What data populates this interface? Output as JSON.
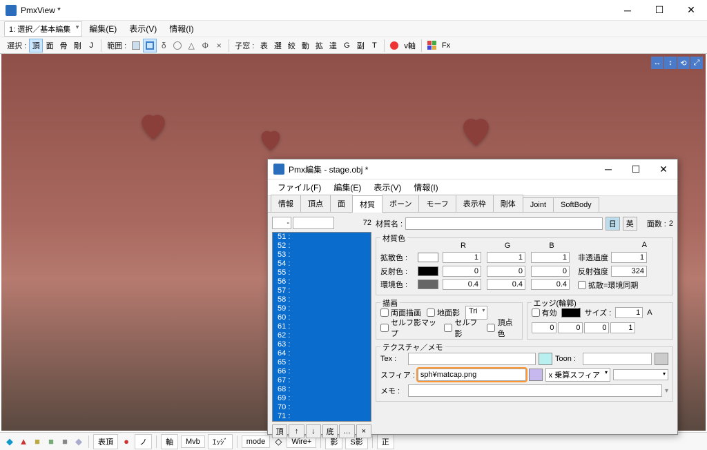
{
  "app": {
    "title": "PmxView *"
  },
  "mainmenu": {
    "mode_dropdown": "1: 選択／基本編集",
    "edit": "編集(E)",
    "view": "表示(V)",
    "info": "情報(I)"
  },
  "toolbar1": {
    "select_label": "選択 :",
    "btn_vertex": "頂",
    "btn_face": "面",
    "btn_bone": "骨",
    "btn_rigid": "剛",
    "btn_j": "J",
    "range_label": "範囲 :",
    "sym_delta": "δ",
    "sym_tri": "△",
    "sym_phi": "Φ",
    "sym_x": "×",
    "sub_label": "子窓 :",
    "sub_table": "表",
    "sub_sel": "選",
    "sub_shibo": "絞",
    "sub_dou": "動",
    "sub_kaku": "拡",
    "sub_tatsu": "達",
    "sub_g": "G",
    "sub_fuku": "副",
    "sub_t": "T",
    "axis": "v軸",
    "fx": "Fx"
  },
  "viewport_nav": [
    "↔",
    "↕",
    "⟲",
    "⤢"
  ],
  "bottombar": {
    "hyoujou": "表頂",
    "nori": "ノ",
    "axis": "軸",
    "mvb": "Mvb",
    "edge": "ｴｯｼﾞ",
    "mode": "mode",
    "wire": "Wire+",
    "kage": "影",
    "skage": "S影",
    "sei": "正"
  },
  "modal": {
    "title": "Pmx編集 - stage.obj *",
    "menu": {
      "file": "ファイル(F)",
      "edit": "編集(E)",
      "view": "表示(V)",
      "info": "情報(I)"
    },
    "tabs": [
      "情報",
      "頂点",
      "面",
      "材質",
      "ボーン",
      "モーフ",
      "表示枠",
      "剛体",
      "Joint",
      "SoftBody"
    ],
    "active_tab": 3,
    "left": {
      "count": "72",
      "items": [
        "51",
        "52",
        "53",
        "54",
        "55",
        "56",
        "57",
        "58",
        "59",
        "60",
        "61",
        "62",
        "63",
        "64",
        "65",
        "66",
        "67",
        "68",
        "69",
        "70",
        "71"
      ],
      "btns": [
        "頂",
        "↑",
        "↓",
        "底",
        "…",
        "×"
      ]
    },
    "right": {
      "name_label": "材質名 :",
      "name_value": "",
      "jp": "日",
      "en": "英",
      "faces_label": "面数 :",
      "faces_value": "2",
      "color_group": "材質色",
      "headers": {
        "r": "R",
        "g": "G",
        "b": "B",
        "a": "A"
      },
      "diffuse_label": "拡散色 :",
      "diffuse": {
        "swatch": "#ffffff",
        "r": "1",
        "g": "1",
        "b": "1"
      },
      "opacity_label": "非透過度",
      "opacity": "1",
      "reflect_label": "反射色 :",
      "reflect": {
        "swatch": "#000000",
        "r": "0",
        "g": "0",
        "b": "0"
      },
      "reflect_str_label": "反射強度",
      "reflect_str": "324",
      "ambient_label": "環境色 :",
      "ambient": {
        "swatch": "#666666",
        "r": "0.4",
        "g": "0.4",
        "b": "0.4"
      },
      "sync_label": "拡散=環境同期",
      "draw_group": "描画",
      "cb_both": "両面描画",
      "cb_ground": "地面影",
      "tri": "Tri",
      "cb_selfmap": "セルフ影マップ",
      "cb_self": "セルフ影",
      "cb_vcol": "頂点色",
      "edge_group": "エッジ(輪郭)",
      "cb_enable": "有効",
      "size_label": "サイズ :",
      "size": "1",
      "size_a": "A",
      "edge_vals": [
        "0",
        "0",
        "0",
        "1"
      ],
      "tex_group": "テクスチャ／メモ",
      "tex_label": "Tex :",
      "tex_value": "",
      "toon_label": "Toon :",
      "toon_value": "",
      "sph_label": "スフィア :",
      "sph_value": "sph¥matcap.png",
      "sph_mode": "x 乗算スフィア",
      "memo_label": "メモ :",
      "memo_value": ""
    }
  },
  "chart_data": null
}
